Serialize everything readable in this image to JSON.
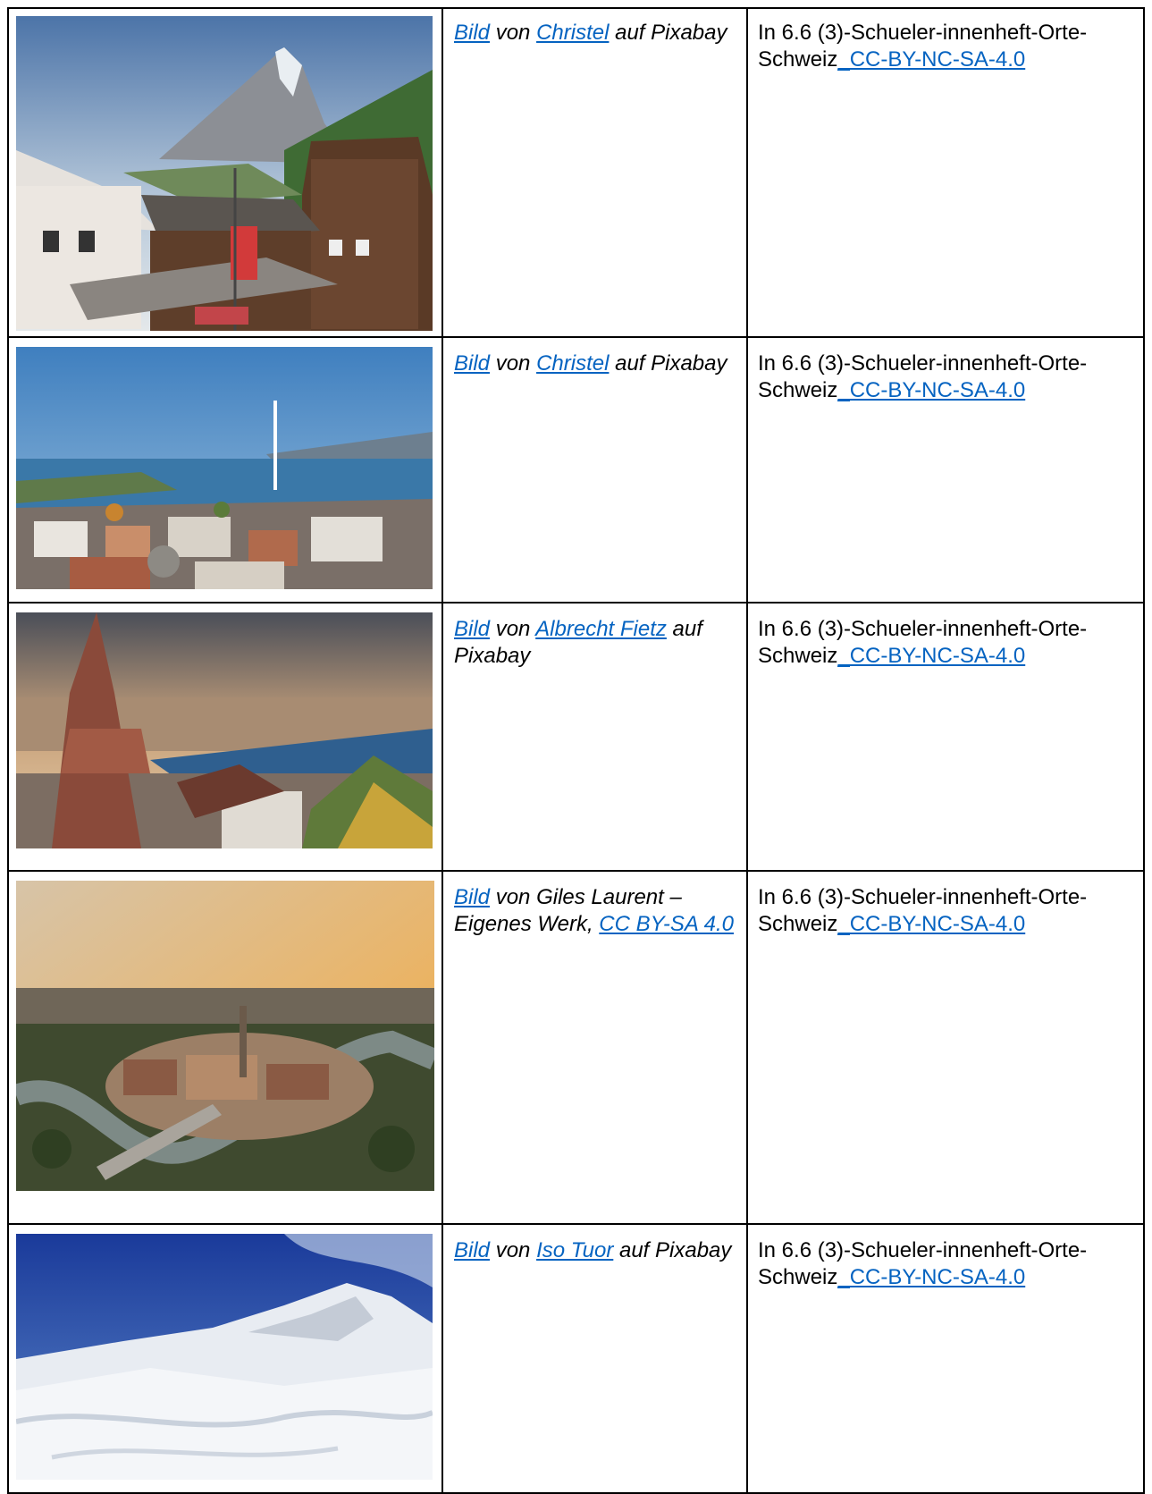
{
  "rows": [
    {
      "scene": "matterhorn-village",
      "credit": {
        "prefix_link": "Bild",
        "mid1": " von ",
        "author_link": "Christel",
        "mid2": " auf Pixabay"
      },
      "usage": {
        "text": "In 6.6 (3)-Schueler-innenheft-Orte-Schweiz",
        "license_link": "_CC-BY-NC-SA-4.0"
      }
    },
    {
      "scene": "geneva-lake",
      "credit": {
        "prefix_link": "Bild",
        "mid1": " von ",
        "author_link": "Christel",
        "mid2": " auf Pixabay"
      },
      "usage": {
        "text": "In 6.6 (3)-Schueler-innenheft-Orte-Schweiz",
        "license_link": "_CC-BY-NC-SA-4.0"
      }
    },
    {
      "scene": "basel-cathedral-rhine",
      "credit": {
        "prefix_link": "Bild",
        "mid1": " von ",
        "author_link": "Albrecht Fietz",
        "mid2": " auf Pixabay"
      },
      "usage": {
        "text": "In 6.6 (3)-Schueler-innenheft-Orte-Schweiz",
        "license_link": "_CC-BY-NC-SA-4.0"
      }
    },
    {
      "scene": "bern-old-town",
      "credit": {
        "prefix_link": "Bild",
        "mid1": " von Giles Laurent – Eigenes Werk, ",
        "author_link": "CC BY-SA 4.0",
        "mid2": ""
      },
      "usage": {
        "text": "In 6.6 (3)-Schueler-innenheft-Orte-Schweiz",
        "license_link": "_CC-BY-NC-SA-4.0"
      }
    },
    {
      "scene": "snowy-mountains",
      "credit": {
        "prefix_link": "Bild",
        "mid1": " von ",
        "author_link": "Iso Tuor",
        "mid2": " auf Pixabay"
      },
      "usage": {
        "text": "In 6.6 (3)-Schueler-innenheft-Orte-Schweiz",
        "license_link": "_CC-BY-NC-SA-4.0"
      }
    }
  ]
}
